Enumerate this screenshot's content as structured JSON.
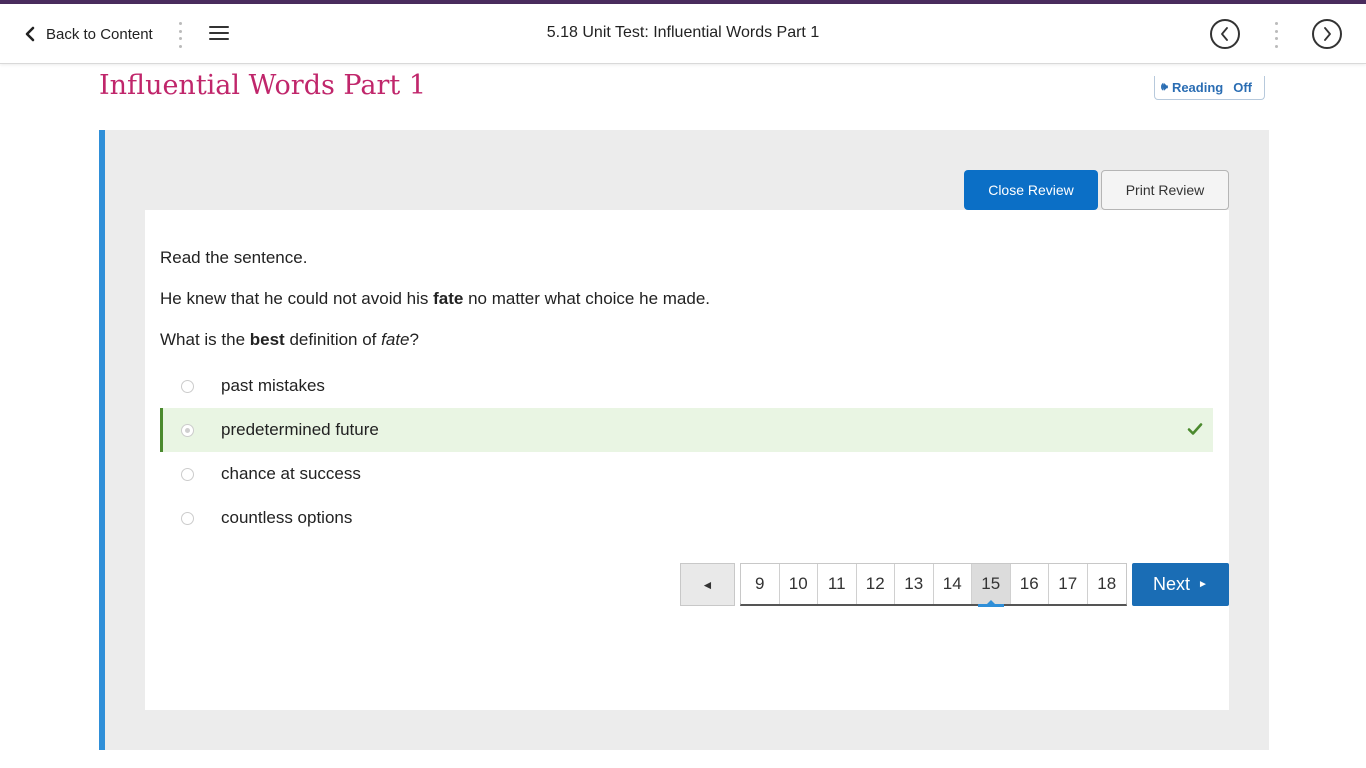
{
  "header": {
    "back_label": "Back to Content",
    "title": "5.18 Unit Test: Influential Words Part 1",
    "prev_icon": "chevron-left-circle-icon",
    "next_icon": "chevron-right-circle-icon",
    "menu_icon": "hamburger-menu-icon"
  },
  "page": {
    "heading": "Influential Words Part 1",
    "reading_label": "Reading",
    "reading_state": "Off"
  },
  "review": {
    "close_label": "Close Review",
    "print_label": "Print Review"
  },
  "question": {
    "intro": "Read the sentence.",
    "sentence_before": "He knew that he could not avoid his ",
    "sentence_bold": "fate",
    "sentence_after": " no matter what choice he made.",
    "prompt_before": "What is the ",
    "prompt_bold": "best",
    "prompt_middle": " definition of ",
    "prompt_italic": "fate",
    "prompt_after": "?",
    "options": [
      {
        "label": "past mistakes",
        "correct": false
      },
      {
        "label": "predetermined future",
        "correct": true
      },
      {
        "label": "chance at success",
        "correct": false
      },
      {
        "label": "countless options",
        "correct": false
      }
    ]
  },
  "pagination": {
    "prev_symbol": "◄",
    "pages": [
      "9",
      "10",
      "11",
      "12",
      "13",
      "14",
      "15",
      "16",
      "17",
      "18"
    ],
    "current": "15",
    "next_label": "Next",
    "next_symbol": "►"
  },
  "colors": {
    "brand_purple": "#4a2c5e",
    "heading_magenta": "#c0266b",
    "primary_blue": "#0b6fc6",
    "accent_blue": "#2f8fd8",
    "correct_green": "#4b8a2e",
    "correct_bg": "#e9f5e3"
  }
}
